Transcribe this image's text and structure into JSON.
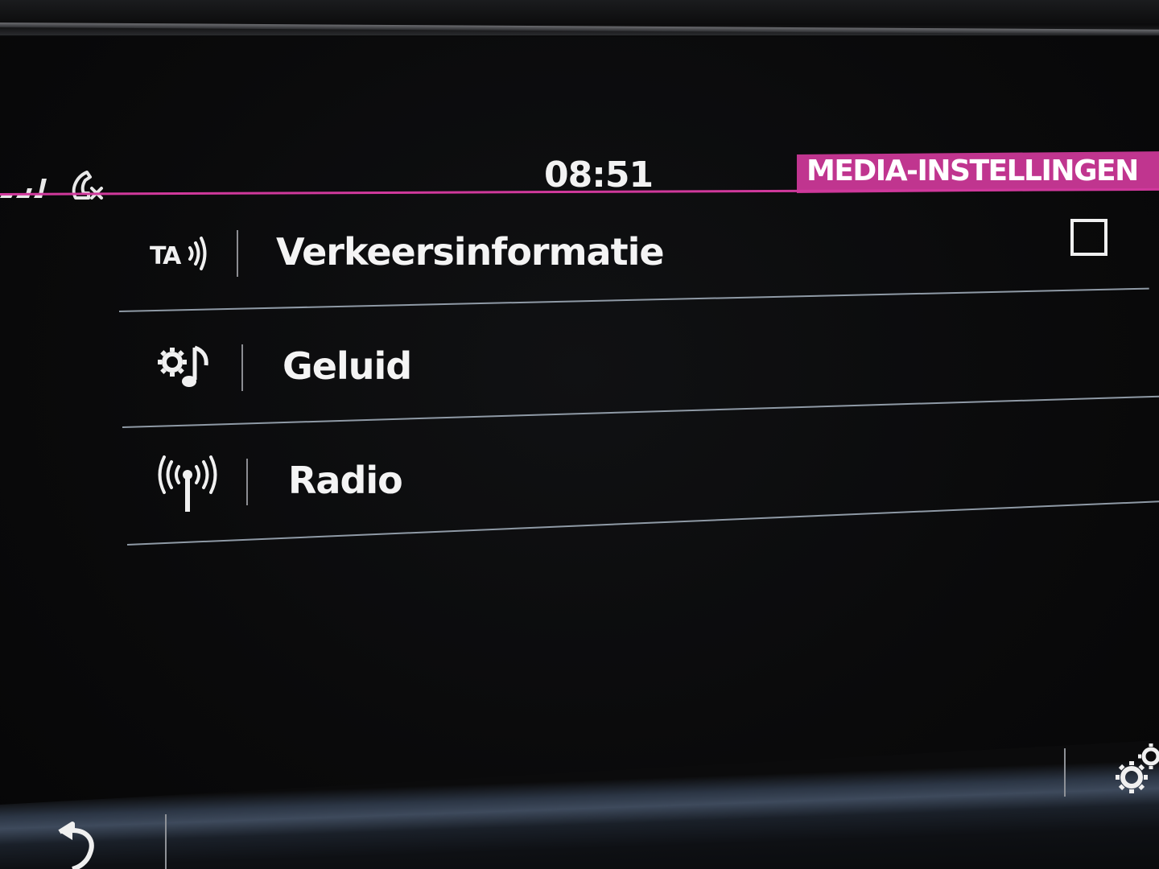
{
  "status_bar": {
    "time": "08:51",
    "icons": [
      "signal-bars-icon",
      "phone-missed-icon"
    ]
  },
  "header": {
    "title": "MEDIA-INSTELLINGEN",
    "accent_color": "#c0358f"
  },
  "menu": {
    "items": [
      {
        "label": "Verkeersinformatie",
        "icon": "traffic-announcement-icon",
        "checked": false
      },
      {
        "label": "Geluid",
        "icon": "sound-settings-icon"
      },
      {
        "label": "Radio",
        "icon": "radio-antenna-icon"
      }
    ]
  },
  "bottom_bar": {
    "icons": [
      "back-arrow-icon",
      "settings-gears-icon"
    ]
  }
}
